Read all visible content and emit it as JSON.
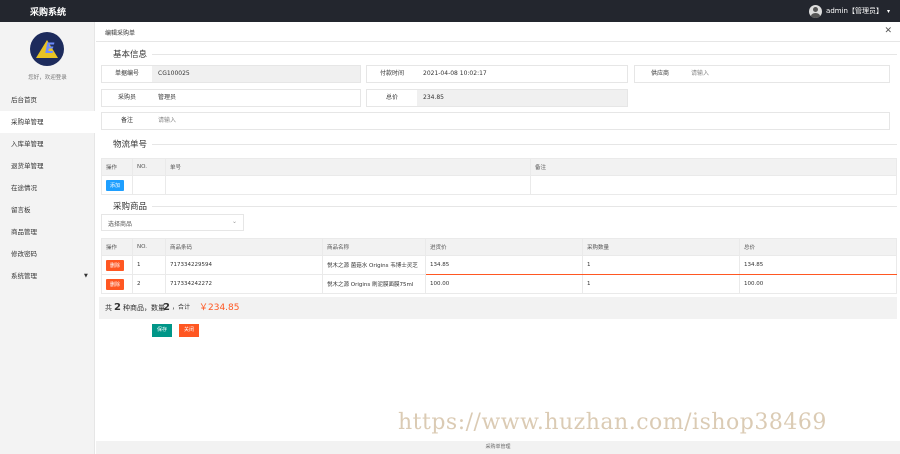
{
  "app_title": "采购系统",
  "user": {
    "name": "admin【管理员】",
    "caret": "▾"
  },
  "sidebar": {
    "welcome": "您好，欢迎登录",
    "items": [
      {
        "label": "后台首页"
      },
      {
        "label": "采购单管理"
      },
      {
        "label": "入库单管理"
      },
      {
        "label": "退货单管理"
      },
      {
        "label": "在途情况"
      },
      {
        "label": "留言板"
      },
      {
        "label": "商品管理"
      },
      {
        "label": "修改密码"
      },
      {
        "label": "系统管理",
        "arrow": "▼"
      }
    ]
  },
  "tab": {
    "label": "编辑采购单",
    "close": "✕"
  },
  "basic_info": {
    "title": "基本信息",
    "order_no": {
      "label": "单据编号",
      "value": "CG100025"
    },
    "pay_time": {
      "label": "付款时间",
      "value": "2021-04-08 10:02:17"
    },
    "supplier": {
      "label": "供应商",
      "placeholder": "请输入"
    },
    "buyer": {
      "label": "采购员",
      "value": "管理员"
    },
    "total": {
      "label": "总价",
      "value": "234.85"
    },
    "remark": {
      "label": "备注",
      "placeholder": "请输入"
    }
  },
  "logistics": {
    "title": "物流单号",
    "headers": [
      "操作",
      "NO.",
      "单号",
      "备注"
    ],
    "add_button": "添加"
  },
  "goods": {
    "title": "采购商品",
    "select_placeholder": "选择商品",
    "headers": [
      "操作",
      "NO.",
      "商品条码",
      "商品名称",
      "进货价",
      "采购数量",
      "总价"
    ],
    "delete_label": "删除",
    "rows": [
      {
        "no": "1",
        "barcode": "717334229594",
        "name": "悦木之源 菌菇水 Origins 韦博士灵芝",
        "price": "134.85",
        "qty": "1",
        "total": "134.85"
      },
      {
        "no": "2",
        "barcode": "717334242272",
        "name": "悦木之源 Origins 刷泥膜面膜75ml",
        "price": "100.00",
        "qty": "1",
        "total": "100.00"
      }
    ]
  },
  "summary": {
    "prefix": "共",
    "kinds": "2",
    "kinds_unit": "种商品，数量",
    "qty": "2",
    "total_label": "，合计",
    "total": "￥234.85"
  },
  "actions": {
    "save": "保存",
    "close": "关闭"
  },
  "watermark": "https://www.huzhan.com/ishop38469",
  "footer": "采购单管理"
}
